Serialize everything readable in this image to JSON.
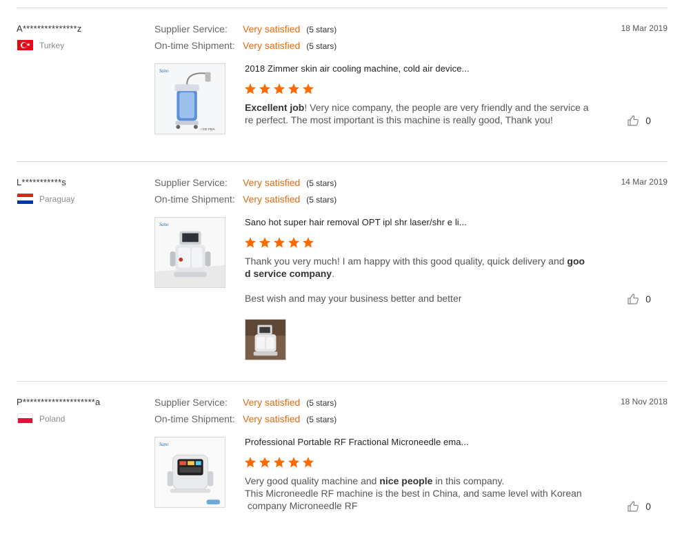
{
  "labels": {
    "supplier_service": "Supplier Service:",
    "ontime_shipment": "On-time Shipment:"
  },
  "colors": {
    "accent": "#e56a0f",
    "star": "#ff6a00"
  },
  "reviews": [
    {
      "buyer": "A***************z",
      "country": "Turkey",
      "flag_icon": "flag-turkey-icon",
      "date": "18 Mar 2019",
      "supplier_service": "Very satisfied",
      "supplier_stars": "(5 stars)",
      "shipment": "Very satisfied",
      "shipment_stars": "(5 stars)",
      "product_title": "2018 Zimmer skin air cooling machine, cold air device...",
      "product_rating": 5,
      "comment_bold": "Excellent job",
      "comment_line1": "! Very nice company, the people are very friendly and the service a",
      "comment_line2": "re perfect. The most important is this machine is really good, Thank you!",
      "likes": "0"
    },
    {
      "buyer": "L***********s",
      "country": "Paraguay",
      "flag_icon": "flag-paraguay-icon",
      "date": "14 Mar 2019",
      "supplier_service": "Very satisfied",
      "supplier_stars": "(5 stars)",
      "shipment": "Very satisfied",
      "shipment_stars": "(5 stars)",
      "product_title": "Sano hot super hair removal OPT ipl shr laser/shr e li...",
      "product_rating": 5,
      "comment_line1": "Thank you very much! I am happy with this good quality, quick delivery and ",
      "comment_bold1": "goo",
      "comment_bold2": "d service company",
      "comment_line2_end": ".",
      "comment_line3": "Best wish and may your business better and better",
      "likes": "0"
    },
    {
      "buyer": "P********************a",
      "country": "Poland",
      "flag_icon": "flag-poland-icon",
      "date": "18 Nov 2018",
      "supplier_service": "Very satisfied",
      "supplier_stars": "(5 stars)",
      "shipment": "Very satisfied",
      "shipment_stars": "(5 stars)",
      "product_title": "Professional Portable RF Fractional Microneedle ema...",
      "product_rating": 5,
      "comment_line1": "Very good quality machine and ",
      "comment_bold": "nice people",
      "comment_line1_end": " in this company.",
      "comment_line2": "This Microneedle RF machine is the best in China, and same level with Korean",
      "comment_line3": " company Microneedle RF",
      "likes": "0"
    }
  ]
}
